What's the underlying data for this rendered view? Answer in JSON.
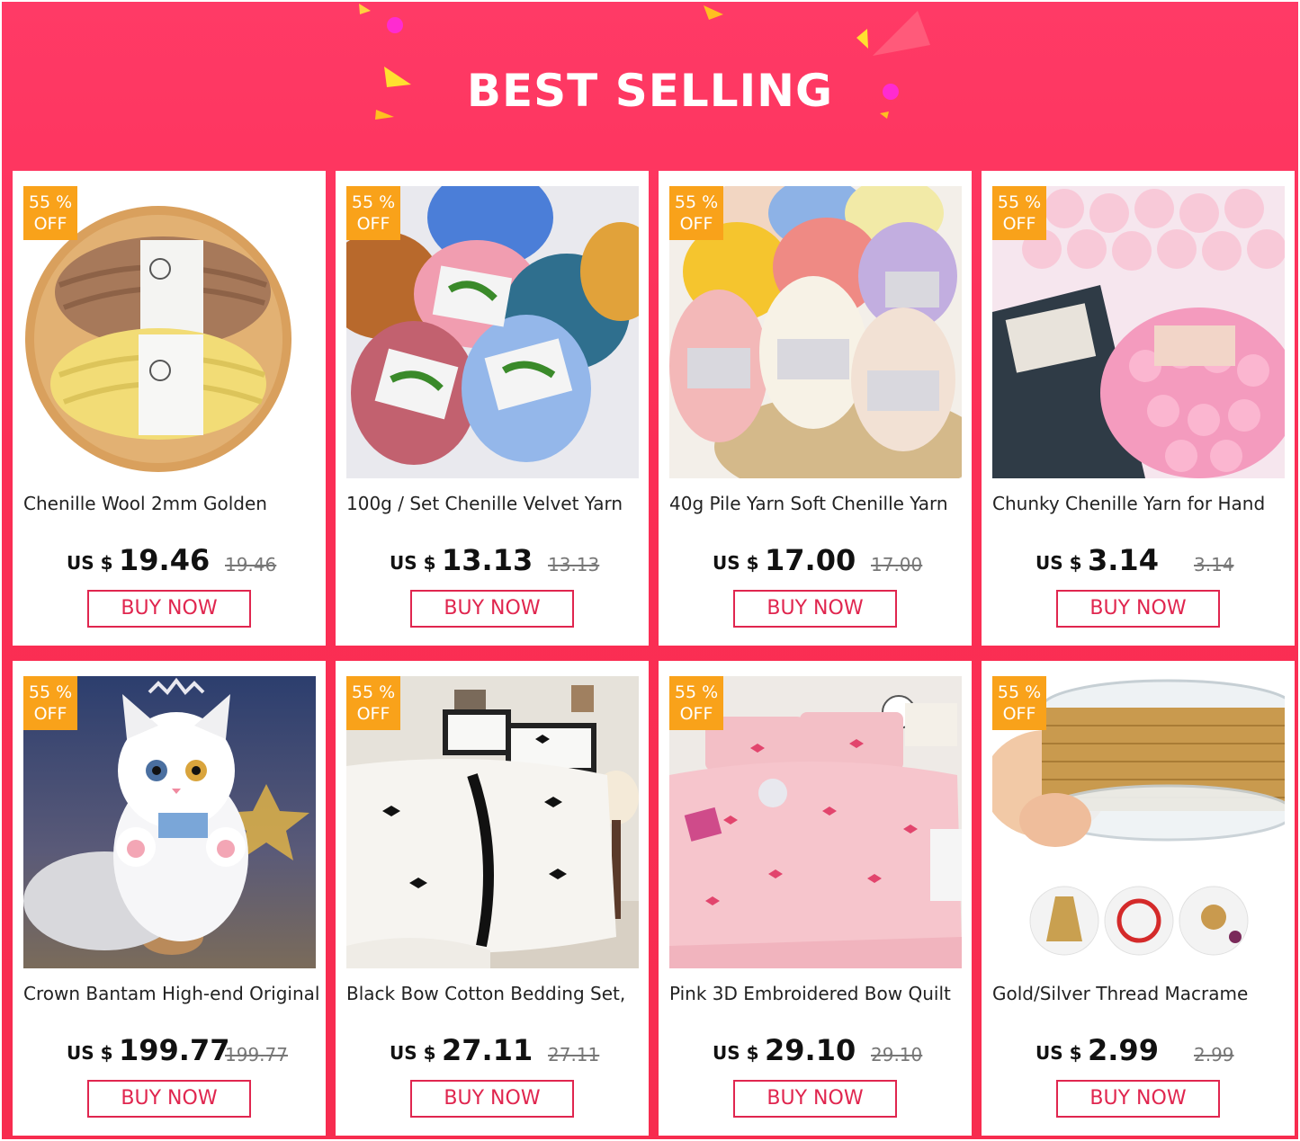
{
  "banner": {
    "title": "BEST SELLING"
  },
  "colors": {
    "banner_red": "#f72c4f",
    "badge_orange": "#f9a21a",
    "button_red": "#e0264f"
  },
  "products": [
    {
      "name": "Chenille Wool 2mm Golden",
      "discount": "55 %",
      "discount_word": "OFF",
      "currency": "US $",
      "price": "19.46",
      "original_price": "19.46",
      "button": "BUY NOW",
      "image": "yarn-balls-brown-yellow"
    },
    {
      "name": "100g / Set Chenille Velvet Yarn",
      "discount": "55 %",
      "discount_word": "OFF",
      "currency": "US $",
      "price": "13.13",
      "original_price": "13.13",
      "button": "BUY NOW",
      "image": "colorful-velvet-yarn"
    },
    {
      "name": "40g Pile Yarn Soft Chenille Yarn",
      "discount": "55 %",
      "discount_word": "OFF",
      "currency": "US $",
      "price": "17.00",
      "original_price": "17.00",
      "button": "BUY NOW",
      "image": "pastel-yarn-basket"
    },
    {
      "name": "Chunky Chenille Yarn for Hand",
      "discount": "55 %",
      "discount_word": "OFF",
      "currency": "US $",
      "price": "3.14",
      "original_price": "3.14",
      "button": "BUY NOW",
      "image": "pink-chunky-yarn"
    },
    {
      "name": "Crown Bantam High-end Original",
      "discount": "55 %",
      "discount_word": "OFF",
      "currency": "US $",
      "price": "199.77",
      "original_price": "199.77",
      "button": "BUY NOW",
      "image": "white-cat-plush"
    },
    {
      "name": "Black Bow Cotton Bedding Set,",
      "discount": "55 %",
      "discount_word": "OFF",
      "currency": "US $",
      "price": "27.11",
      "original_price": "27.11",
      "button": "BUY NOW",
      "image": "white-bedding-black-bows"
    },
    {
      "name": "Pink 3D Embroidered Bow Quilt",
      "discount": "55 %",
      "discount_word": "OFF",
      "currency": "US $",
      "price": "29.10",
      "original_price": "29.10",
      "button": "BUY NOW",
      "image": "pink-bow-quilt"
    },
    {
      "name": "Gold/Silver Thread Macrame",
      "discount": "55 %",
      "discount_word": "OFF",
      "currency": "US $",
      "price": "2.99",
      "original_price": "2.99",
      "button": "BUY NOW",
      "image": "gold-thread-spool"
    }
  ]
}
